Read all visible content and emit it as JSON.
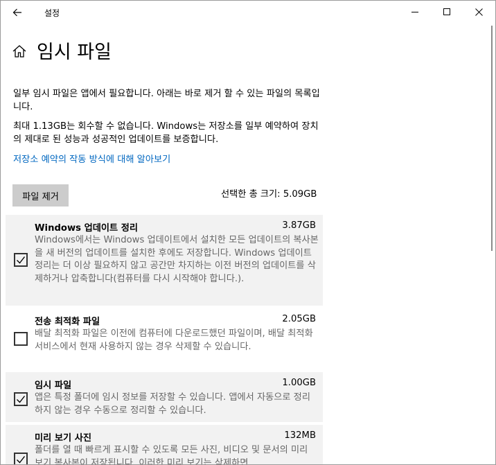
{
  "window": {
    "title": "설정",
    "controls": {
      "minimize_icon": "minimize-icon",
      "maximize_icon": "maximize-icon",
      "close_icon": "close-icon"
    }
  },
  "header": {
    "title": "임시 파일",
    "icon": "home-icon"
  },
  "intro": {
    "p1": "일부 임시 파일은 앱에서 필요합니다. 아래는 바로 제거 할 수 있는 파일의 목록입니다.",
    "p2": "최대 1.13GB는 회수할 수 없습니다. Windows는 저장소를 일부 예약하여 장치의 제대로 된 성능과 성공적인 업데이트를 보증합니다.",
    "link": "저장소 예약의 작동 방식에 대해 알아보기"
  },
  "actions": {
    "remove_label": "파일 제거",
    "total_label": "선택한 총 크기: 5.09GB"
  },
  "items": [
    {
      "name": "Windows 업데이트 정리",
      "size": "3.87GB",
      "checked": true,
      "desc": "Windows에서는 Windows 업데이트에서 설치한 모든 업데이트의 복사본을 새 버전의 업데이트를 설치한 후에도 저장합니다. Windows 업데이트 정리는 더 이상 필요하지 않고 공간만 차지하는 이전 버전의 업데이트를 삭제하거나 압축합니다(컴퓨터를 다시 시작해야 합니다.)."
    },
    {
      "name": "전송 최적화 파일",
      "size": "2.05GB",
      "checked": false,
      "desc": "배달 최적화 파일은 이전에 컴퓨터에 다운로드했던 파일이며, 배달 최적화 서비스에서 현재 사용하지 않는 경우 삭제할 수 있습니다."
    },
    {
      "name": "임시 파일",
      "size": "1.00GB",
      "checked": true,
      "desc": "앱은 특정 폴더에 임시 정보를 저장할 수 있습니다. 앱에서 자동으로 정리하지 않는 경우 수동으로 정리할 수 있습니다."
    },
    {
      "name": "미리 보기 사진",
      "size": "132MB",
      "checked": true,
      "desc": "폴더를 열 때 빠르게 표시할 수 있도록 모든 사진, 비디오 및 문서의 미리 보기 복사본이 저장됩니다. 이러한 미리 보기는 삭제하면"
    }
  ]
}
